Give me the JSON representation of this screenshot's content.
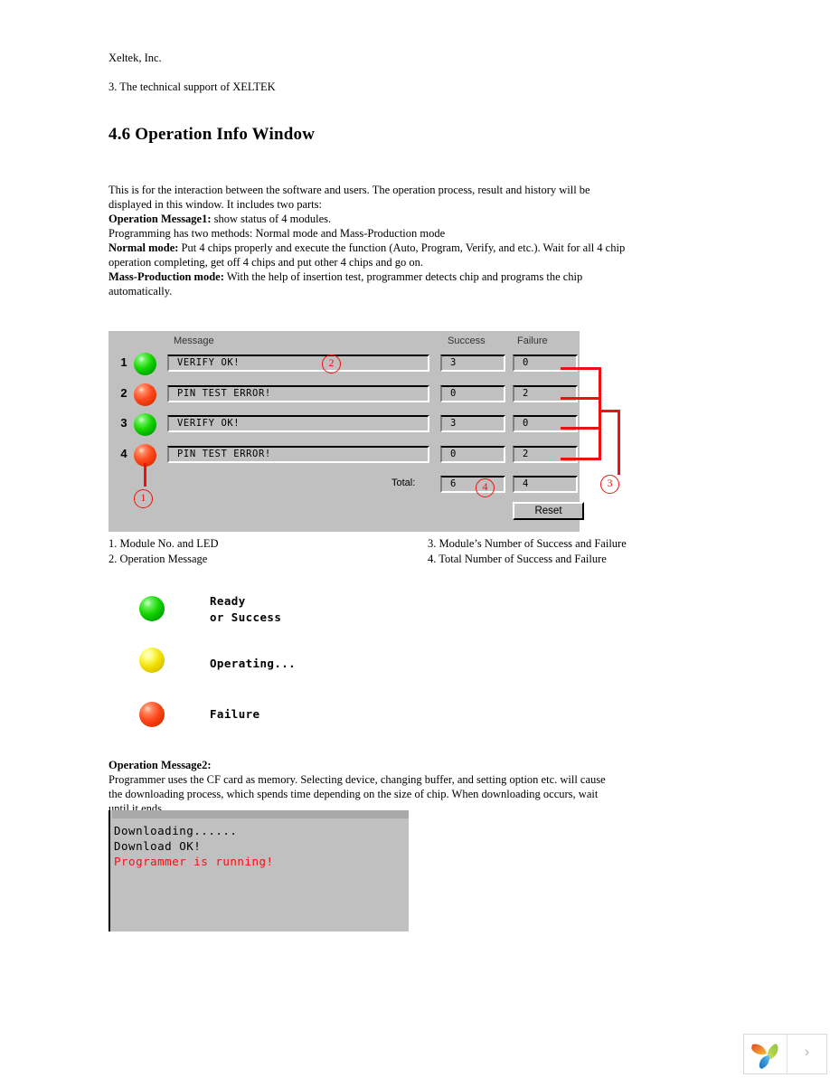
{
  "header": {
    "company": "Xeltek, Inc.",
    "support_line": "3. The technical support of XELTEK",
    "section_title": "4.6 Operation Info Window"
  },
  "intro": {
    "p1": "This is for the interaction  between the software and users. The operation process, result and history will be displayed in this window. It includes two parts:",
    "p2_bold": "Operation Message1:",
    "p2_rest": " show status of 4 modules.",
    "p3": "Programming has two methods: Normal mode and Mass-Production mode",
    "p4_bold": "Normal mode:",
    "p4_rest": "  Put 4 chips properly and execute the function (Auto, Program, Verify, and etc.). Wait for all 4 chip operation completing, get off 4 chips and put other 4 chips and go on.",
    "p5_bold": "Mass-Production mode:",
    "p5_rest": " With the help of insertion test, programmer detects chip and programs the chip automatically."
  },
  "panel": {
    "columns": {
      "message": "Message",
      "success": "Success",
      "failure": "Failure"
    },
    "rows": [
      {
        "no": "1",
        "led": "green",
        "message": "VERIFY OK!",
        "success": "3",
        "failure": "0"
      },
      {
        "no": "2",
        "led": "red",
        "message": "PIN TEST ERROR!",
        "success": "0",
        "failure": "2"
      },
      {
        "no": "3",
        "led": "green",
        "message": "VERIFY OK!",
        "success": "3",
        "failure": "0"
      },
      {
        "no": "4",
        "led": "red",
        "message": "PIN TEST ERROR!",
        "success": "0",
        "failure": "2"
      }
    ],
    "total_label": "Total:",
    "total_success": "6",
    "total_failure": "4",
    "reset_label": "Reset"
  },
  "annotations": {
    "a1": "1",
    "a2": "2",
    "a3": "3",
    "a4": "4",
    "color": "#ee1111"
  },
  "captions": {
    "left": [
      "1. Module No. and LED",
      "2. Operation Message"
    ],
    "right": [
      "3. Module’s Number of Success and Failure",
      "4. Total Number of Success and Failure"
    ]
  },
  "legend": [
    {
      "led": "green",
      "line1": "Ready",
      "line2": "or Success"
    },
    {
      "led": "yellow",
      "line1": "Operating...",
      "line2": ""
    },
    {
      "led": "red",
      "line1": "Failure",
      "line2": ""
    }
  ],
  "message2": {
    "title": "Operation Message2:",
    "body": "Programmer uses the CF card as memory. Selecting device, changing buffer, and setting option etc. will cause the downloading process, which spends time depending on the size of chip. When downloading occurs, wait until  it ends."
  },
  "console": {
    "lines": [
      {
        "text": "Downloading......",
        "color": "#000000"
      },
      {
        "text": "Download OK!",
        "color": "#000000"
      },
      {
        "text": "Programmer is running!",
        "color": "#ee1111"
      }
    ]
  },
  "footer": {
    "logo_name": "leaf-logo",
    "arrow": "›"
  }
}
